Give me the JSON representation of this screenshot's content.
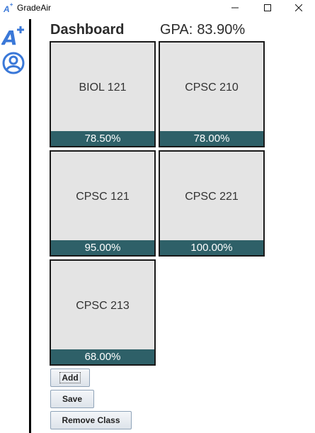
{
  "window": {
    "title": "GradeAir",
    "logo_icon": "a-plus-logo-icon",
    "controls": [
      "minimize-icon",
      "maximize-icon",
      "close-icon"
    ]
  },
  "sidebar": {
    "items": [
      {
        "icon": "a-plus-icon"
      },
      {
        "icon": "user-profile-icon"
      }
    ],
    "accent_color": "#3a78d8"
  },
  "header": {
    "title": "Dashboard",
    "gpa_label": "GPA:",
    "gpa_value": "83.90%"
  },
  "courses": [
    {
      "name": "BIOL 121",
      "grade": "78.50%"
    },
    {
      "name": "CPSC 210",
      "grade": "78.00%"
    },
    {
      "name": "CPSC 121",
      "grade": "95.00%"
    },
    {
      "name": "CPSC 221",
      "grade": "100.00%"
    },
    {
      "name": "CPSC 213",
      "grade": "68.00%"
    }
  ],
  "buttons": {
    "add": "Add",
    "save": "Save",
    "remove": "Remove Class"
  },
  "colors": {
    "card_background": "#e4e4e4",
    "grade_bar": "#2e6068"
  }
}
